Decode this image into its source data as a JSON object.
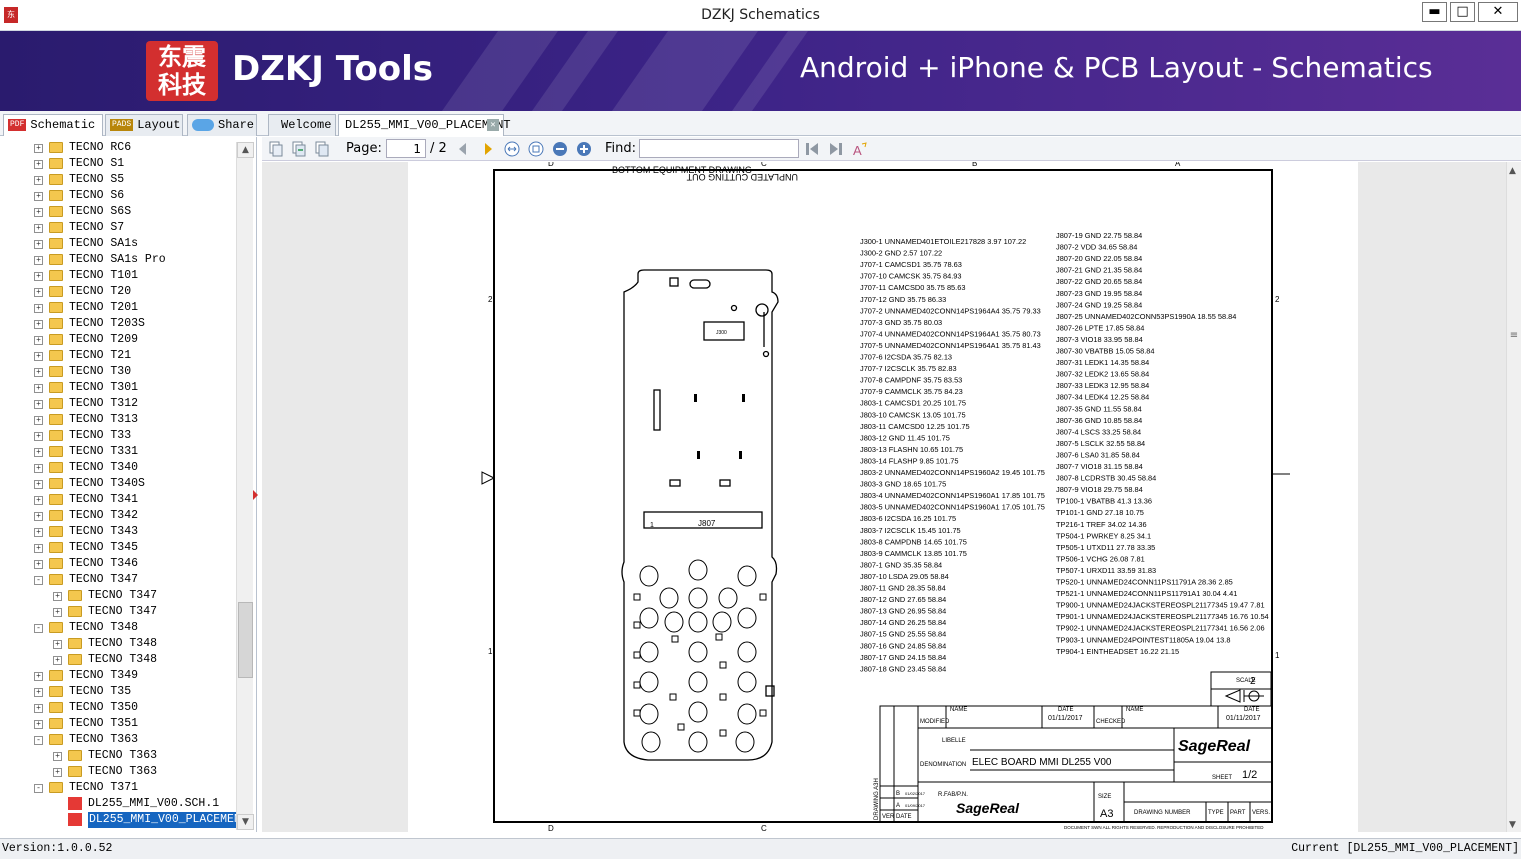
{
  "window": {
    "title": "DZKJ Schematics",
    "min": "▬",
    "max": "□",
    "close": "✕"
  },
  "banner": {
    "logo_line1": "东震",
    "logo_line2": "科技",
    "brand": "DZKJ Tools",
    "tagline": "Android + iPhone & PCB Layout - Schematics"
  },
  "tabs": {
    "schematic": {
      "badge": "PDF",
      "label": "Schematic"
    },
    "layout": {
      "badge": "PADS",
      "label": "Layout"
    },
    "share": {
      "label": "Share"
    },
    "welcome": {
      "label": "Welcome"
    },
    "doc": {
      "label": "DL255_MMI_V00_PLACEMENT"
    }
  },
  "toolbar": {
    "page_label": "Page:",
    "page_value": "1",
    "page_total": "/ 2",
    "find_label": "Find:",
    "find_value": ""
  },
  "tree": [
    {
      "label": "TECNO RC6",
      "lvl": 1,
      "type": "folder",
      "exp": "+"
    },
    {
      "label": "TECNO S1",
      "lvl": 1,
      "type": "folder",
      "exp": "+"
    },
    {
      "label": "TECNO S5",
      "lvl": 1,
      "type": "folder",
      "exp": "+"
    },
    {
      "label": "TECNO S6",
      "lvl": 1,
      "type": "folder",
      "exp": "+"
    },
    {
      "label": "TECNO S6S",
      "lvl": 1,
      "type": "folder",
      "exp": "+"
    },
    {
      "label": "TECNO S7",
      "lvl": 1,
      "type": "folder",
      "exp": "+"
    },
    {
      "label": "TECNO SA1s",
      "lvl": 1,
      "type": "folder",
      "exp": "+"
    },
    {
      "label": "TECNO SA1s Pro",
      "lvl": 1,
      "type": "folder",
      "exp": "+"
    },
    {
      "label": "TECNO T101",
      "lvl": 1,
      "type": "folder",
      "exp": "+"
    },
    {
      "label": "TECNO T20",
      "lvl": 1,
      "type": "folder",
      "exp": "+"
    },
    {
      "label": "TECNO T201",
      "lvl": 1,
      "type": "folder",
      "exp": "+"
    },
    {
      "label": "TECNO T203S",
      "lvl": 1,
      "type": "folder",
      "exp": "+"
    },
    {
      "label": "TECNO T209",
      "lvl": 1,
      "type": "folder",
      "exp": "+"
    },
    {
      "label": "TECNO T21",
      "lvl": 1,
      "type": "folder",
      "exp": "+"
    },
    {
      "label": "TECNO T30",
      "lvl": 1,
      "type": "folder",
      "exp": "+"
    },
    {
      "label": "TECNO T301",
      "lvl": 1,
      "type": "folder",
      "exp": "+"
    },
    {
      "label": "TECNO T312",
      "lvl": 1,
      "type": "folder",
      "exp": "+"
    },
    {
      "label": "TECNO T313",
      "lvl": 1,
      "type": "folder",
      "exp": "+"
    },
    {
      "label": "TECNO T33",
      "lvl": 1,
      "type": "folder",
      "exp": "+"
    },
    {
      "label": "TECNO T331",
      "lvl": 1,
      "type": "folder",
      "exp": "+"
    },
    {
      "label": "TECNO T340",
      "lvl": 1,
      "type": "folder",
      "exp": "+"
    },
    {
      "label": "TECNO T340S",
      "lvl": 1,
      "type": "folder",
      "exp": "+"
    },
    {
      "label": "TECNO T341",
      "lvl": 1,
      "type": "folder",
      "exp": "+"
    },
    {
      "label": "TECNO T342",
      "lvl": 1,
      "type": "folder",
      "exp": "+"
    },
    {
      "label": "TECNO T343",
      "lvl": 1,
      "type": "folder",
      "exp": "+"
    },
    {
      "label": "TECNO T345",
      "lvl": 1,
      "type": "folder",
      "exp": "+"
    },
    {
      "label": "TECNO T346",
      "lvl": 1,
      "type": "folder",
      "exp": "+"
    },
    {
      "label": "TECNO T347",
      "lvl": 1,
      "type": "folder",
      "exp": "-"
    },
    {
      "label": "TECNO T347",
      "lvl": 2,
      "type": "folder",
      "exp": "+"
    },
    {
      "label": "TECNO T347",
      "lvl": 2,
      "type": "folder",
      "exp": "+"
    },
    {
      "label": "TECNO T348",
      "lvl": 1,
      "type": "folder",
      "exp": "-"
    },
    {
      "label": "TECNO T348",
      "lvl": 2,
      "type": "folder",
      "exp": "+"
    },
    {
      "label": "TECNO T348",
      "lvl": 2,
      "type": "folder",
      "exp": "+"
    },
    {
      "label": "TECNO T349",
      "lvl": 1,
      "type": "folder",
      "exp": "+"
    },
    {
      "label": "TECNO T35",
      "lvl": 1,
      "type": "folder",
      "exp": "+"
    },
    {
      "label": "TECNO T350",
      "lvl": 1,
      "type": "folder",
      "exp": "+"
    },
    {
      "label": "TECNO T351",
      "lvl": 1,
      "type": "folder",
      "exp": "+"
    },
    {
      "label": "TECNO T363",
      "lvl": 1,
      "type": "folder",
      "exp": "-"
    },
    {
      "label": "TECNO T363",
      "lvl": 2,
      "type": "folder",
      "exp": "+"
    },
    {
      "label": "TECNO T363",
      "lvl": 2,
      "type": "folder",
      "exp": "+"
    },
    {
      "label": "TECNO T371",
      "lvl": 1,
      "type": "folder",
      "exp": "-"
    },
    {
      "label": "DL255_MMI_V00.SCH.1",
      "lvl": 2,
      "type": "pdf",
      "exp": ""
    },
    {
      "label": "DL255_MMI_V00_PLACEMENT",
      "lvl": 2,
      "type": "pdf",
      "exp": "",
      "selected": true
    }
  ],
  "sheet": {
    "header_text": "BOTTOM EQUIPMENT DRAWING",
    "header_text2": "UNPLATED CUTTING OUT",
    "col_letters": [
      "D",
      "C",
      "B",
      "A"
    ],
    "row_numbers": [
      "2",
      "1"
    ],
    "board_label": "J807",
    "board_label2": "J300",
    "col1": [
      "J300-1 UNNAMED401ETOILE217828 3.97 107.22",
      "J300-2 GND 2.57 107.22",
      "J707-1 CAMCSD1 35.75 78.63",
      "J707-10 CAMCSK 35.75 84.93",
      "J707-11 CAMCSD0 35.75 85.63",
      "J707-12 GND 35.75 86.33",
      "J707-2 UNNAMED402CONN14PS1964A4 35.75 79.33",
      "J707-3 GND 35.75 80.03",
      "J707-4 UNNAMED402CONN14PS1964A1 35.75 80.73",
      "J707-5 UNNAMED402CONN14PS1964A1 35.75 81.43",
      "J707-6 I2CSDA 35.75 82.13",
      "J707-7 I2CSCLK 35.75 82.83",
      "J707-8 CAMPDNF 35.75 83.53",
      "J707-9 CAMMCLK 35.75 84.23",
      "J803-1 CAMCSD1 20.25 101.75",
      "J803-10 CAMCSK 13.05 101.75",
      "J803-11 CAMCSD0 12.25 101.75",
      "J803-12 GND 11.45 101.75",
      "J803-13 FLASHN 10.65 101.75",
      "J803-14 FLASHP 9.85 101.75",
      "J803-2 UNNAMED402CONN14PS1960A2 19.45 101.75",
      "J803-3 GND 18.65 101.75",
      "J803-4 UNNAMED402CONN14PS1960A1 17.85 101.75",
      "J803-5 UNNAMED402CONN14PS1960A1 17.05 101.75",
      "J803-6 I2CSDA 16.25 101.75",
      "J803-7 I2CSCLK 15.45 101.75",
      "J803-8 CAMPDNB 14.65 101.75",
      "J803-9 CAMMCLK 13.85 101.75",
      "J807-1 GND 35.35 58.84",
      "J807-10 LSDA 29.05 58.84",
      "J807-11 GND 28.35 58.84",
      "J807-12 GND 27.65 58.84",
      "J807-13 GND 26.95 58.84",
      "J807-14 GND 26.25 58.84",
      "J807-15 GND 25.55 58.84",
      "J807-16 GND 24.85 58.84",
      "J807-17 GND 24.15 58.84",
      "J807-18 GND 23.45 58.84"
    ],
    "col2": [
      "J807-19 GND 22.75 58.84",
      "J807-2 VDD 34.65 58.84",
      "J807-20 GND 22.05 58.84",
      "J807-21 GND 21.35 58.84",
      "J807-22 GND 20.65 58.84",
      "J807-23 GND 19.95 58.84",
      "J807-24 GND 19.25 58.84",
      "J807-25 UNNAMED402CONN53PS1990A 18.55 58.84",
      "J807-26 LPTE 17.85 58.84",
      "J807-3 VIO18 33.95 58.84",
      "J807-30 VBATBB 15.05 58.84",
      "J807-31 LEDK1 14.35 58.84",
      "J807-32 LEDK2 13.65 58.84",
      "J807-33 LEDK3 12.95 58.84",
      "J807-34 LEDK4 12.25 58.84",
      "J807-35 GND 11.55 58.84",
      "J807-36 GND 10.85 58.84",
      "J807-4 LSCS 33.25 58.84",
      "J807-5 LSCLK 32.55 58.84",
      "J807-6 LSA0 31.85 58.84",
      "J807-7 VIO18 31.15 58.84",
      "J807-8 LCDRSTB 30.45 58.84",
      "J807-9 VIO18 29.75 58.84",
      "TP100-1 VBATBB 41.3 13.36",
      "TP101-1 GND 27.18 10.75",
      "TP216-1 TREF 34.02 14.36",
      "TP504-1 PWRKEY 8.25 34.1",
      "TP505-1 UTXD11 27.78 33.35",
      "TP506-1 VCHG 26.08 7.81",
      "TP507-1 URXD11 33.59 31.83",
      "TP520-1 UNNAMED24CONN11PS11791A 28.36 2.85",
      "TP521-1 UNNAMED24CONN11PS11791A1 30.04 4.41",
      "TP900-1 UNNAMED24JACKSTEREOSPL21177345 19.47 7.81",
      "TP901-1 UNNAMED24JACKSTEREOSPL21177345 16.76 10.54",
      "TP902-1 UNNAMED24JACKSTEREOSPL21177341 16.56 2.06",
      "TP903-1 UNNAMED24POINTEST11805A 19.04 13.8",
      "TP904-1 EINTHEADSET 16.22 21.15"
    ],
    "titleblock": {
      "scale_label": "SCALE",
      "scale_value": "2",
      "modified": "MODIFIED",
      "checked": "CHECKED",
      "name_label": "NAME",
      "date_label": "DATE",
      "date1": "01/11/2017",
      "date2": "01/11/2017",
      "libelle": "LIBELLE",
      "denomination": "DENOMINATION",
      "denom_value": "ELEC BOARD MMI DL255 V00",
      "sheet_label": "SHEET",
      "sheet_value": "1/2",
      "rfab": "R.FAB/P.N.",
      "size_label": "SIZE",
      "size_value": "A3",
      "drawing_number": "DRAWING NUMBER",
      "type": "TYPE",
      "part": "PART",
      "vers": "VERS.",
      "drawing_vert": "DRAWING A3H",
      "ver": "VER",
      "date_short": "DATE",
      "rev_b": "B",
      "rev_a": "A",
      "rev_b_date": "01/02/2017",
      "rev_a_date": "01/09/2017",
      "brand": "SageReal",
      "copyright": "DOCUMENT SWN ALL RIGHTS RESERVED. REPRODUCTION AND DISCLOSURE PROHIBITED"
    }
  },
  "status": {
    "version": "Version:1.0.0.52",
    "current": "Current [DL255_MMI_V00_PLACEMENT]"
  }
}
